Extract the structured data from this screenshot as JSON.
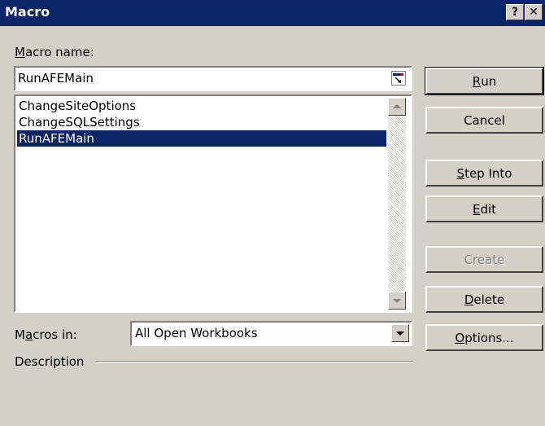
{
  "window": {
    "title": "Macro"
  },
  "titlebar": {
    "help_label": "?",
    "close_label": "✕"
  },
  "macro_name": {
    "label_underline": "M",
    "label_rest": "acro name:",
    "value": "RunAFEMain"
  },
  "macro_list": {
    "items": [
      {
        "label": "ChangeSiteOptions",
        "selected": false
      },
      {
        "label": "ChangeSQLSettings",
        "selected": false
      },
      {
        "label": "RunAFEMain",
        "selected": true
      }
    ]
  },
  "macros_in": {
    "label_pre": "M",
    "label_underline": "a",
    "label_rest": "cros in:",
    "value": "All Open Workbooks"
  },
  "description": {
    "label": "Description"
  },
  "buttons": {
    "run": {
      "underline": "R",
      "rest": "un"
    },
    "cancel": {
      "label": "Cancel"
    },
    "step_into": {
      "underline": "S",
      "rest": "tep Into"
    },
    "edit": {
      "underline": "E",
      "rest": "dit"
    },
    "create": {
      "label": "Create",
      "enabled": false
    },
    "delete": {
      "underline": "D",
      "rest": "elete"
    },
    "options": {
      "underline": "O",
      "rest": "ptions..."
    }
  },
  "colors": {
    "titlebar": "#0a246a",
    "selection": "#0a246a",
    "face": "#d4d0c8"
  }
}
